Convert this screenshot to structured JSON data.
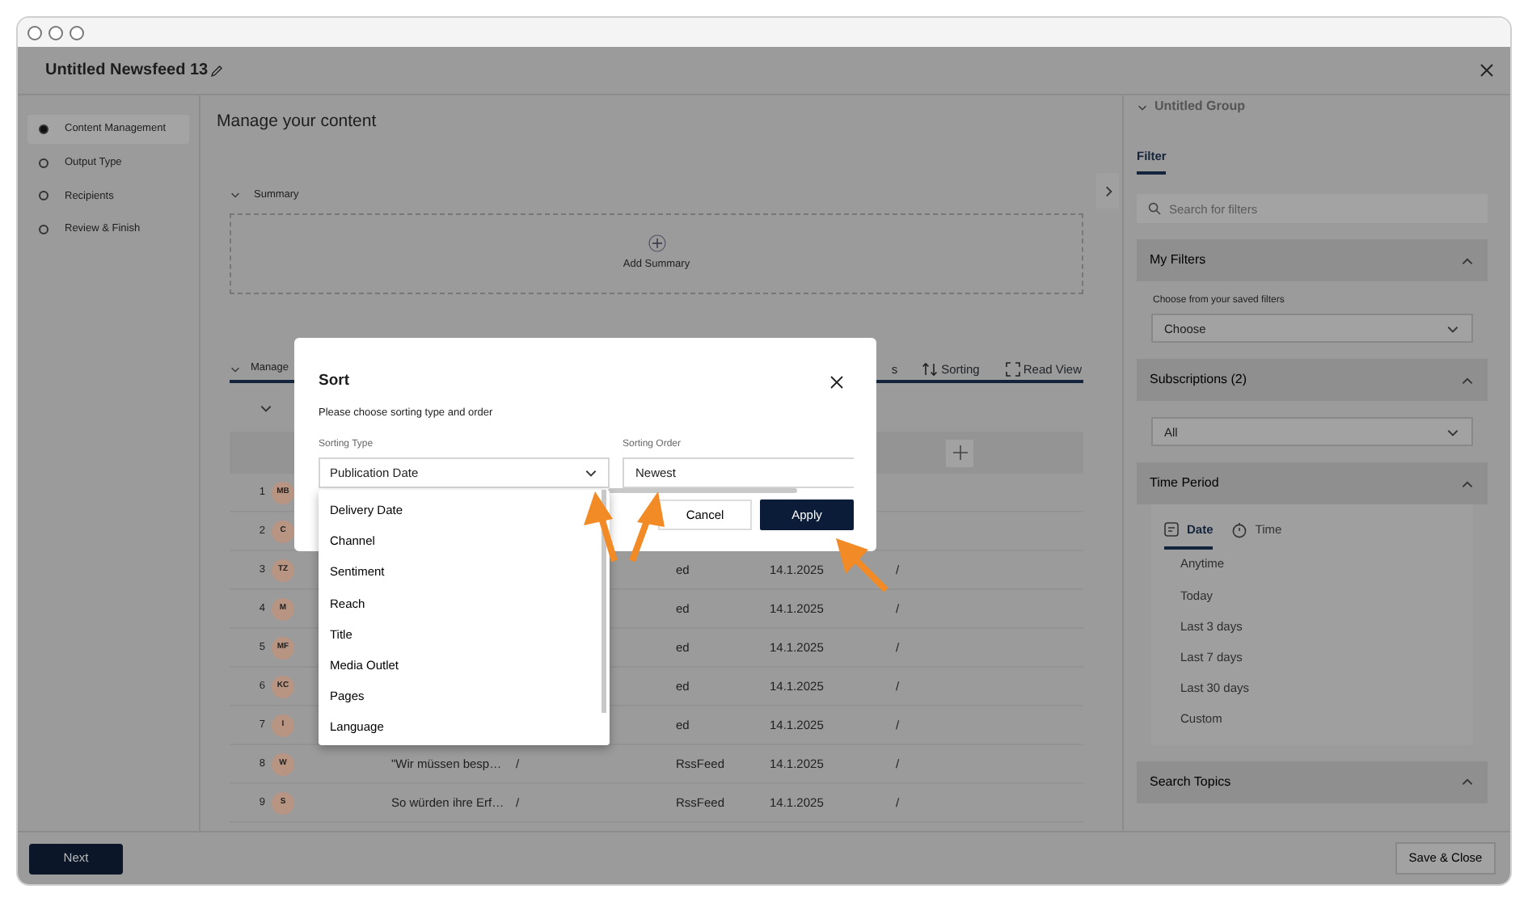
{
  "window": {
    "title": "Untitled Newsfeed 13"
  },
  "steps": [
    {
      "label": "Content Management",
      "selected": true
    },
    {
      "label": "Output Type",
      "selected": false
    },
    {
      "label": "Recipients",
      "selected": false
    },
    {
      "label": "Review & Finish",
      "selected": false
    }
  ],
  "main": {
    "heading": "Manage your content",
    "summary": {
      "label": "Summary",
      "add_label": "Add Summary"
    },
    "toolbar": {
      "section": "Manage",
      "cut_label": "s",
      "sorting": "Sorting",
      "read_view": "Read View"
    },
    "rows": [
      {
        "number": "1",
        "initials": "MB"
      },
      {
        "number": "2",
        "initials": "C"
      },
      {
        "number": "3",
        "initials": "TZ",
        "channel": "ed",
        "date": "14.1.2025",
        "column_5": "/"
      },
      {
        "number": "4",
        "initials": "M",
        "channel": "ed",
        "date": "14.1.2025",
        "column_5": "/"
      },
      {
        "number": "5",
        "initials": "MF",
        "channel": "ed",
        "date": "14.1.2025",
        "column_5": "/"
      },
      {
        "number": "6",
        "initials": "KC",
        "channel": "ed",
        "date": "14.1.2025",
        "column_5": "/"
      },
      {
        "number": "7",
        "initials": "I",
        "channel": "ed",
        "date": "14.1.2025",
        "column_5": "/"
      },
      {
        "number": "8",
        "initials": "W",
        "title": "\"Wir müssen besp…",
        "title_sep": "/",
        "channel": "RssFeed",
        "date": "14.1.2025",
        "column_5": "/"
      },
      {
        "number": "9",
        "initials": "S",
        "title": "So würden ihre Erf…",
        "title_sep": "/",
        "channel": "RssFeed",
        "date": "14.1.2025",
        "column_5": "/"
      }
    ]
  },
  "sort_dialog": {
    "title": "Sort",
    "subtitle": "Please choose sorting type and order",
    "type_label": "Sorting Type",
    "type_value": "Publication Date",
    "order_label": "Sorting Order",
    "order_value": "Newest",
    "options": [
      "Delivery Date",
      "Channel",
      "Sentiment",
      "Reach",
      "Title",
      "Media Outlet",
      "Pages",
      "Language"
    ],
    "cancel": "Cancel",
    "apply": "Apply"
  },
  "filter_panel": {
    "group": "Untitled Group",
    "tabs": [
      {
        "label": "Filter",
        "selected": true
      }
    ],
    "search_placeholder": "Search for filters",
    "sections": [
      {
        "title": "My Filters",
        "expanded": true,
        "kind": "select",
        "hint": "Choose from your saved filters",
        "value": "Choose"
      },
      {
        "title": "Subscriptions (2)",
        "expanded": true,
        "kind": "select",
        "value": "All"
      },
      {
        "title": "Time Period",
        "expanded": true,
        "kind": "time",
        "tabs": [
          {
            "label": "Date",
            "selected": true
          },
          {
            "label": "Time",
            "selected": false
          }
        ],
        "options": [
          "Anytime",
          "Today",
          "Last 3 days",
          "Last 7 days",
          "Last 30 days",
          "Custom"
        ]
      },
      {
        "title": "Search Topics",
        "expanded": true,
        "kind": "empty"
      }
    ]
  },
  "footer": {
    "next": "Next",
    "save": "Save & Close"
  }
}
